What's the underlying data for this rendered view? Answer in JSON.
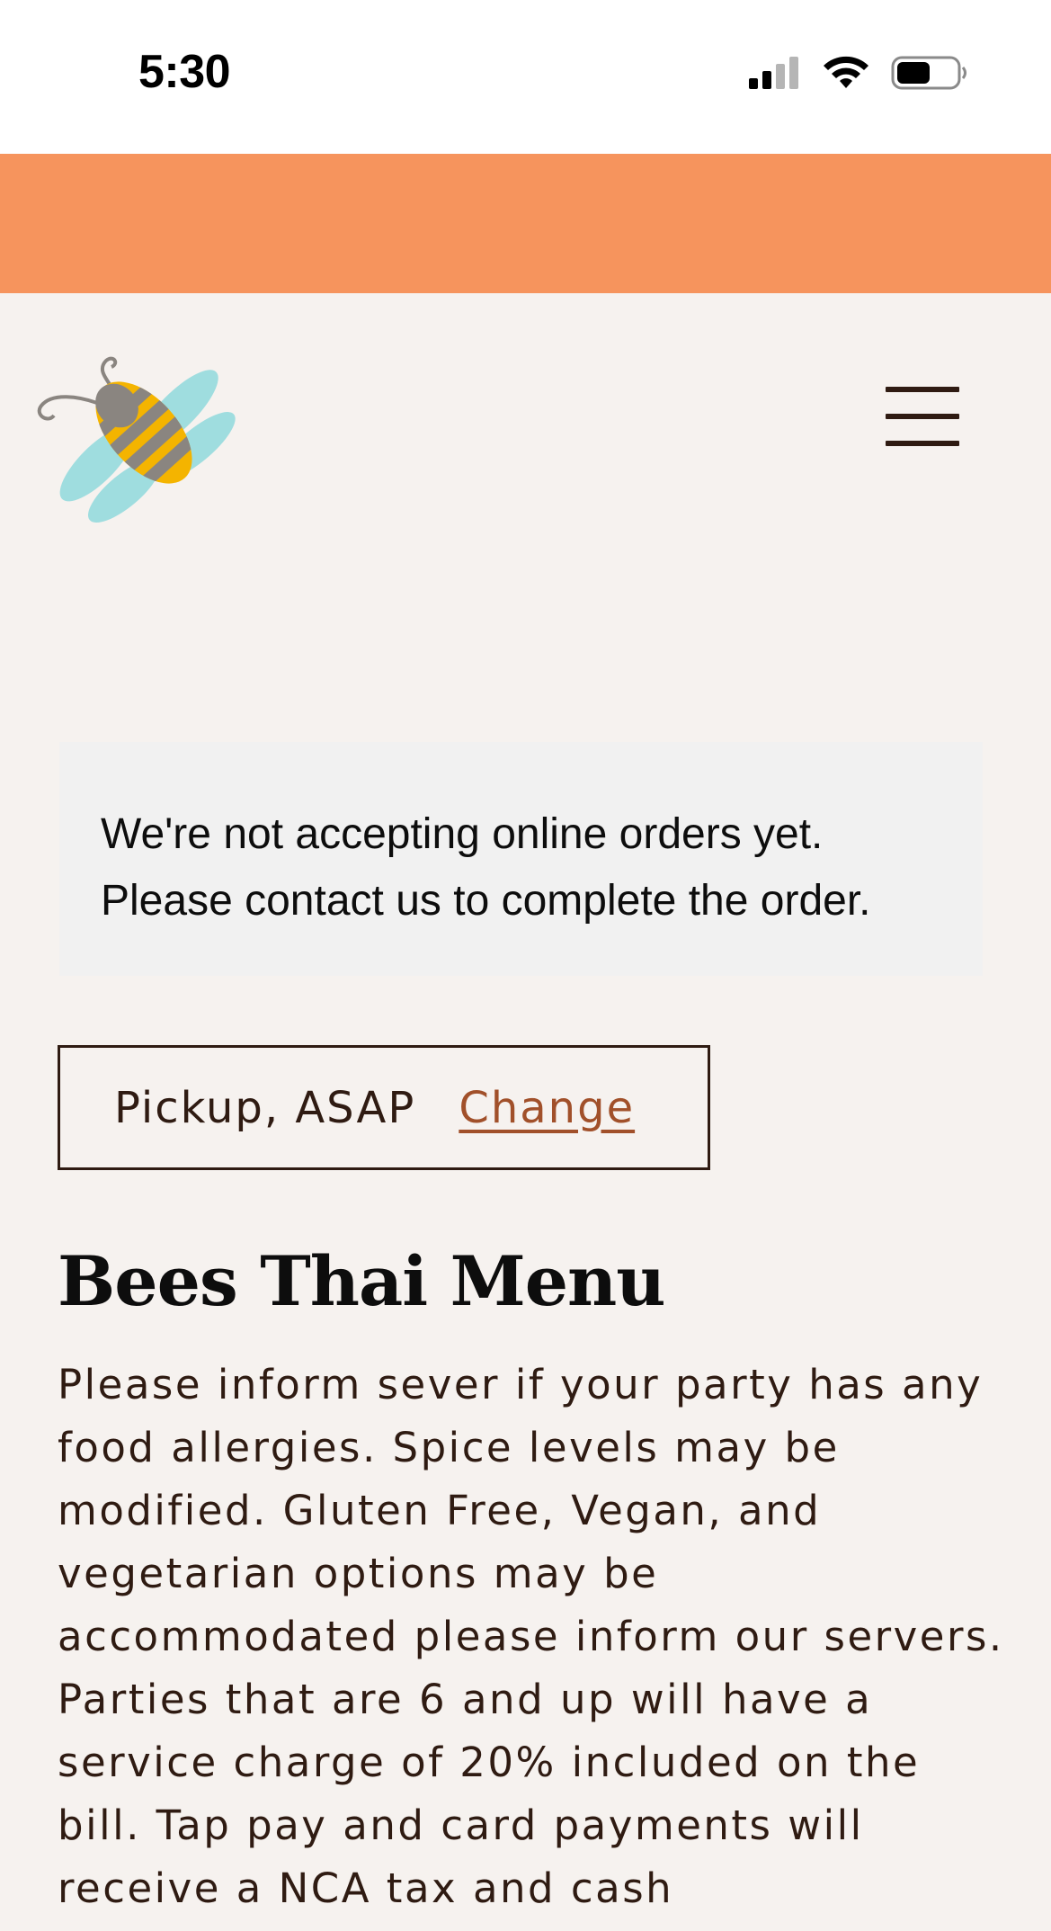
{
  "status_bar": {
    "time": "5:30",
    "icons": [
      "cellular-signal-icon",
      "wifi-icon",
      "battery-icon"
    ]
  },
  "header": {
    "logo": "bee-logo",
    "menu_icon": "hamburger-menu-icon"
  },
  "notice": {
    "line1": "We're not accepting online orders yet.",
    "line2": "Please contact us to complete the order."
  },
  "pickup": {
    "label": "Pickup, ASAP",
    "change_label": "Change"
  },
  "menu": {
    "title": "Bees Thai Menu",
    "description": "Please inform sever if your party has any food allergies. Spice levels may be modified. Gluten Free, Vegan, and vegetarian options may be accommodated please inform our servers. Parties that are 6 and up will have a service charge of 20% included on the bill. Tap pay and card payments will receive a NCA tax and cash"
  },
  "colors": {
    "banner": "#f6945d",
    "page_bg": "#f6f2ef",
    "text": "#2f1b12",
    "link": "#a1502a",
    "notice_bg": "#f1f1f1"
  }
}
